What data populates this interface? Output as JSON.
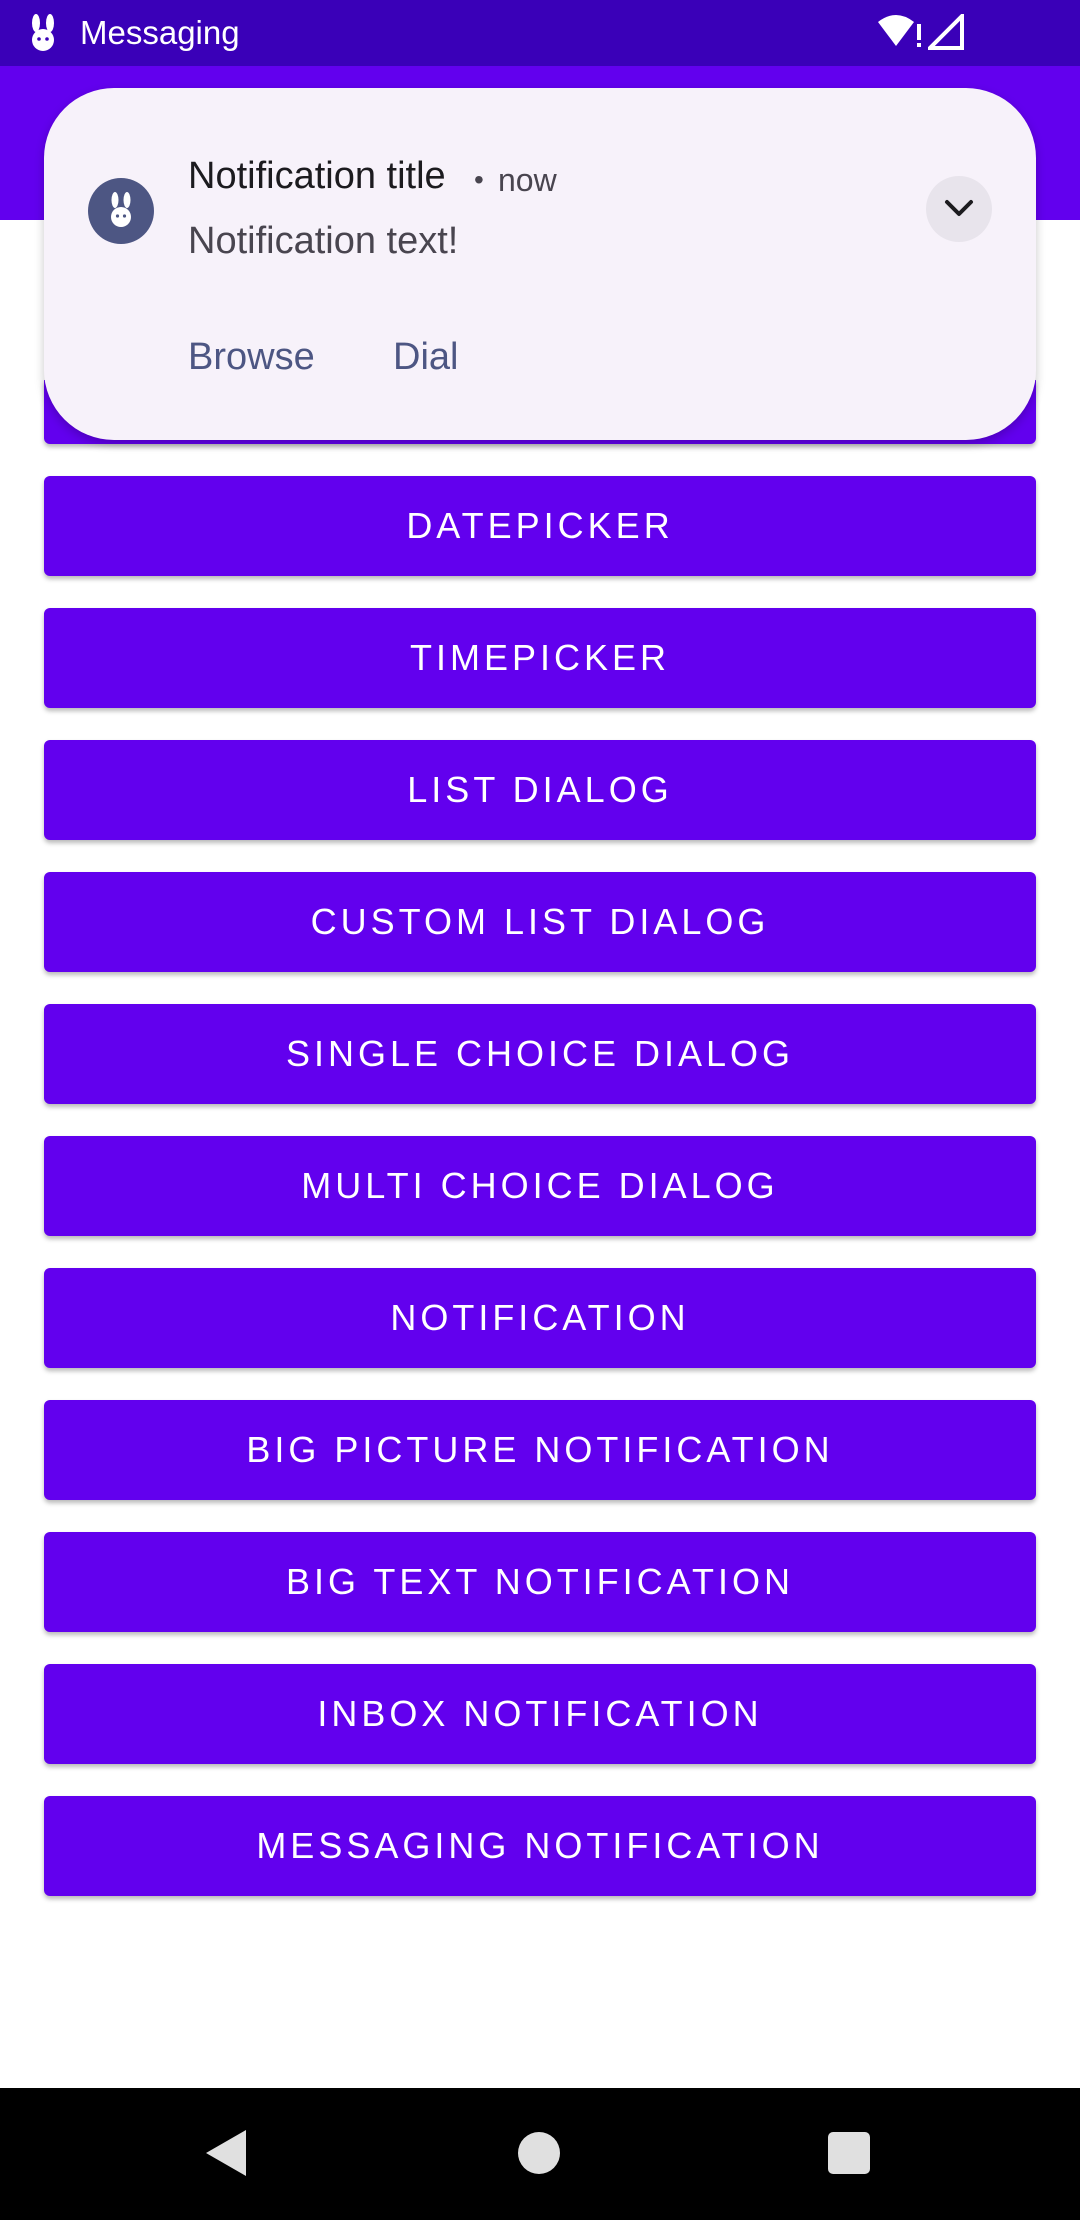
{
  "status_bar": {
    "app_title": "Messaging",
    "app_icon": "rabbit-icon",
    "wifi_icon": "wifi-alert-icon",
    "signal_icon": "cell-signal-icon"
  },
  "notification": {
    "app_icon": "rabbit-icon",
    "title": "Notification title",
    "separator": "•",
    "time": "now",
    "text": "Notification text!",
    "expand_icon": "chevron-down-icon",
    "actions": [
      "Browse",
      "Dial"
    ]
  },
  "buttons": [
    "DATEPICKER",
    "TIMEPICKER",
    "LIST DIALOG",
    "CUSTOM LIST DIALOG",
    "SINGLE CHOICE DIALOG",
    "MULTI CHOICE DIALOG",
    "NOTIFICATION",
    "BIG PICTURE NOTIFICATION",
    "BIG TEXT NOTIFICATION",
    "INBOX NOTIFICATION",
    "MESSAGING NOTIFICATION"
  ],
  "nav_bar": {
    "back_icon": "back-triangle-icon",
    "home_icon": "home-circle-icon",
    "recents_icon": "recents-square-icon"
  },
  "colors": {
    "status_bar": "#3a00b8",
    "primary": "#6200ee",
    "notification_bg": "#f7f2fa",
    "notification_accent": "#4d5683",
    "nav_bar": "#000000"
  }
}
